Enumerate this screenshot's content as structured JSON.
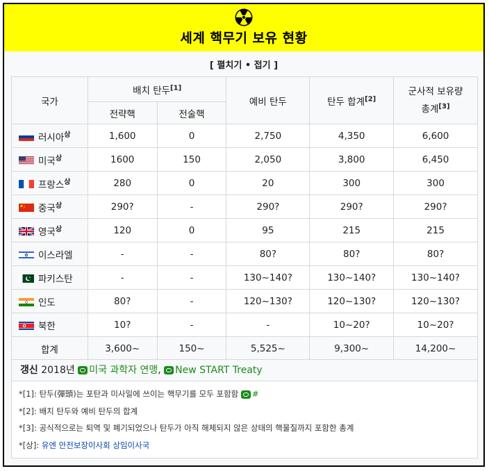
{
  "header": {
    "icon": "radiation-icon",
    "title": "세계 핵무기 보유 현황",
    "background": "#ffff00"
  },
  "toggle": {
    "open_bracket": "[",
    "expand": "펼치기",
    "sep": "•",
    "collapse": "접기",
    "close_bracket": "]"
  },
  "table": {
    "headers": {
      "country": "국가",
      "deployed": "배치 탄두",
      "deployed_note": "[1]",
      "strategic": "전략핵",
      "tactical": "전술핵",
      "reserve": "예비 탄두",
      "total": "탄두 합계",
      "total_note": "[2]",
      "military": "군사적 보유량 총계",
      "military_note": "[3]"
    },
    "rows": [
      {
        "country": "러시아",
        "sup": "상",
        "flag": "russia-flag",
        "strategic": "1,600",
        "tactical": "0",
        "reserve": "2,750",
        "total": "4,350",
        "military": "6,600"
      },
      {
        "country": "미국",
        "sup": "상",
        "flag": "usa-flag",
        "strategic": "1600",
        "tactical": "150",
        "reserve": "2,050",
        "total": "3,800",
        "military": "6,450"
      },
      {
        "country": "프랑스",
        "sup": "상",
        "flag": "france-flag",
        "strategic": "280",
        "tactical": "0",
        "reserve": "20",
        "total": "300",
        "military": "300"
      },
      {
        "country": "중국",
        "sup": "상",
        "flag": "china-flag",
        "strategic": "290?",
        "tactical": "-",
        "reserve": "290?",
        "total": "290?",
        "military": "290?"
      },
      {
        "country": "영국",
        "sup": "상",
        "flag": "uk-flag",
        "strategic": "120",
        "tactical": "0",
        "reserve": "95",
        "total": "215",
        "military": "215"
      },
      {
        "country": "이스라엘",
        "sup": "",
        "flag": "israel-flag",
        "strategic": "-",
        "tactical": "-",
        "reserve": "80?",
        "total": "80?",
        "military": "80?"
      },
      {
        "country": "파키스탄",
        "sup": "",
        "flag": "pakistan-flag",
        "strategic": "-",
        "tactical": "-",
        "reserve": "130~140?",
        "total": "130~140?",
        "military": "130~140?"
      },
      {
        "country": "인도",
        "sup": "",
        "flag": "india-flag",
        "strategic": "80?",
        "tactical": "-",
        "reserve": "120~130?",
        "total": "120~130?",
        "military": "120~130?"
      },
      {
        "country": "북한",
        "sup": "",
        "flag": "north-korea-flag",
        "strategic": "10?",
        "tactical": "-",
        "reserve": "-",
        "total": "10~20?",
        "military": "10~20?"
      }
    ],
    "sum": {
      "label": "합계",
      "strategic": "3,600~",
      "tactical": "150~",
      "reserve": "5,525~",
      "total": "9,300~",
      "military": "14,200~"
    }
  },
  "update": {
    "label": "갱신",
    "year": "2018년",
    "source1": "미국 과학자 연맹",
    "comma": ",",
    "source2": "New START Treaty"
  },
  "notes": [
    {
      "key": "*[1]:",
      "text": "탄두(彈頭)는 포탄과 미사일에 쓰이는 핵무기를 모두 포함함",
      "link": "#"
    },
    {
      "key": "*[2]:",
      "text": "배치 탄두와 예비 탄두의 합계"
    },
    {
      "key": "*[3]:",
      "text": "공식적으로는 퇴역 및 폐기되었으나 탄두가 아직 해체되지 않은 상태의 핵물질까지 포함한 총계"
    },
    {
      "key": "*[상]:",
      "link_text": "유엔 안전보장이사회 상임이사국"
    }
  ],
  "colors": {
    "link_green": "#1a8a1a",
    "link_blue": "#0645ad",
    "border": "#d8d8d8"
  }
}
